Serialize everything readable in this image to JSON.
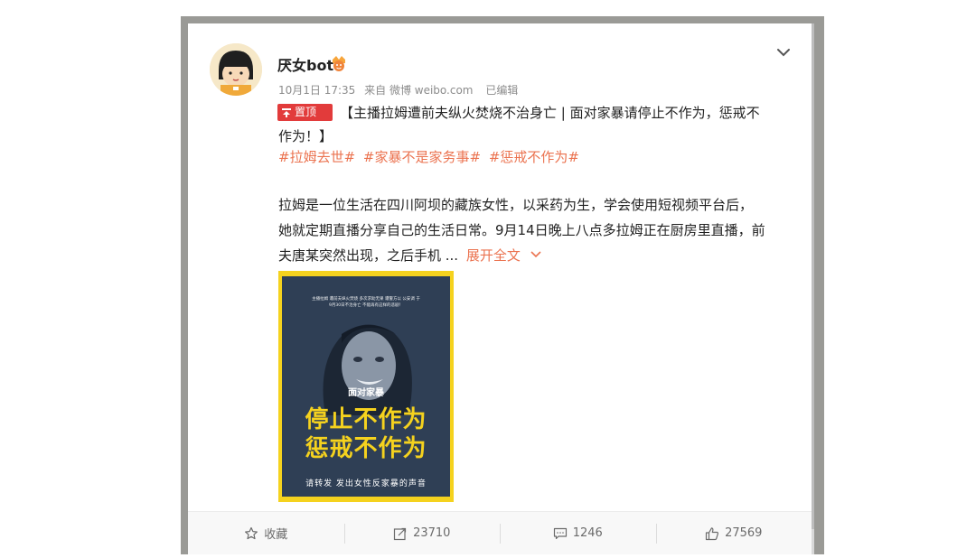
{
  "post": {
    "username": "厌女bot",
    "meta": {
      "date": "10月1日 17:35",
      "source": "来自 微博 weibo.com",
      "edited": "已编辑"
    },
    "pin_label": "置顶",
    "title_line1": "【主播拉姆遭前夫纵火焚烧不治身亡 | 面对家暴请停止不作为，惩戒不",
    "title_line2": "作为！】",
    "hashtags": [
      "#拉姆去世#",
      "#家暴不是家务事#",
      "#惩戒不作为#"
    ],
    "body_lines": [
      "拉姆是一位生活在四川阿坝的藏族女性，以采药为生，学会使用短视频平台后，",
      "她就定期直播分享自己的生活日常。9月14日晚上八点多拉姆正在厨房里直播，前",
      "夫唐某突然出现，之后手机 ..."
    ],
    "expand_label": "展开全文",
    "poster": {
      "top_line1": "主播拉姆 遭前夫纵火焚烧 多次求助无果 遭警方以 公安调 于",
      "top_line2": "9月30日不治身亡  不能再有这样的悲剧！",
      "sub": "面对家暴",
      "headline1": "停止不作为",
      "headline2": "惩戒不作为",
      "bottom": "请转发  发出女性反家暴的声音"
    }
  },
  "toolbar": {
    "favorite_label": "收藏",
    "repost_count": "23710",
    "comment_count": "1246",
    "like_count": "27569"
  },
  "colors": {
    "accent": "#eb7350",
    "pin_bg": "#e23b3b",
    "poster_yellow": "#f5d21e",
    "poster_navy": "#2f3f55"
  }
}
